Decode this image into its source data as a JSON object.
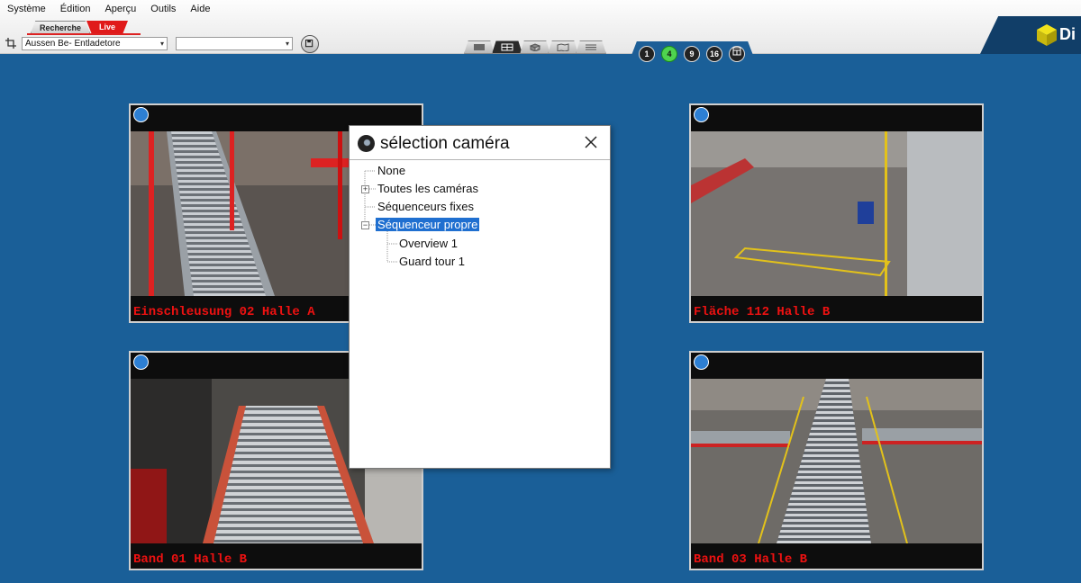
{
  "menu": [
    "Système",
    "Édition",
    "Aperçu",
    "Outils",
    "Aide"
  ],
  "mode_tabs": {
    "search": "Recherche",
    "live": "Live"
  },
  "toolbar": {
    "camera_select": "Aussen Be- Entladetore",
    "secondary_select": ""
  },
  "layout_buttons": [
    {
      "label": "1",
      "active": false
    },
    {
      "label": "4",
      "active": true
    },
    {
      "label": "9",
      "active": false
    },
    {
      "label": "16",
      "active": false
    }
  ],
  "logo": "Di",
  "tiles": [
    {
      "caption": "Einschleusung 02 Halle A"
    },
    {
      "caption": "Fläche 112 Halle B"
    },
    {
      "caption": "Band 01 Halle B"
    },
    {
      "caption": "Band 03 Halle B"
    }
  ],
  "dialog": {
    "title": "sélection caméra",
    "tree": [
      {
        "label": "None"
      },
      {
        "label": "Toutes les caméras"
      },
      {
        "label": "Séquenceurs fixes"
      },
      {
        "label": "Séquenceur propre",
        "selected": true
      },
      {
        "label": "Overview 1"
      },
      {
        "label": "Guard tour 1"
      }
    ]
  },
  "colors": {
    "background": "#1a5f98",
    "caption": "#e11111",
    "live_tab": "#e01a1a",
    "selection": "#1f6fd0",
    "active_layout": "#4fd34f"
  }
}
